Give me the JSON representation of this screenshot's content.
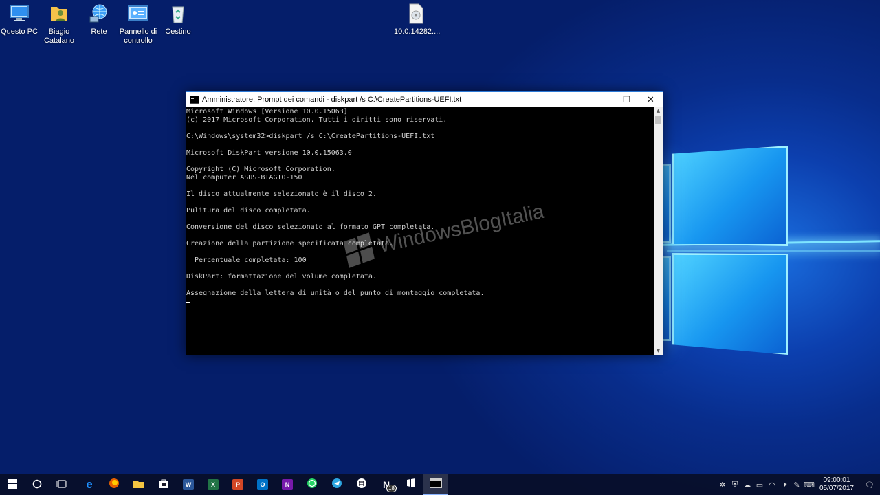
{
  "desktop": {
    "icons": [
      {
        "label": "Questo PC"
      },
      {
        "label": "Biagio Catalano"
      },
      {
        "label": "Rete"
      },
      {
        "label": "Pannello di controllo"
      },
      {
        "label": "Cestino"
      },
      {
        "label": "10.0.14282...."
      }
    ]
  },
  "window": {
    "title": "Amministratore: Prompt dei comandi - diskpart  /s C:\\CreatePartitions-UEFI.txt",
    "minimize_glyph": "—",
    "maximize_glyph": "☐",
    "close_glyph": "✕",
    "console_lines": [
      "Microsoft Windows [Versione 10.0.15063]",
      "(c) 2017 Microsoft Corporation. Tutti i diritti sono riservati.",
      "",
      "C:\\Windows\\system32>diskpart /s C:\\CreatePartitions-UEFI.txt",
      "",
      "Microsoft DiskPart versione 10.0.15063.0",
      "",
      "Copyright (C) Microsoft Corporation.",
      "Nel computer ASUS-BIAGIO-150",
      "",
      "Il disco attualmente selezionato è il disco 2.",
      "",
      "Pulitura del disco completata.",
      "",
      "Conversione del disco selezionato al formato GPT completata.",
      "",
      "Creazione della partizione specificata completata.",
      "",
      "  Percentuale completata: 100",
      "",
      "DiskPart: formattazione del volume completata.",
      "",
      "Assegnazione della lettera di unità o del punto di montaggio completata."
    ]
  },
  "watermark": "WindowsBlogItalia",
  "taskbar": {
    "apps": [
      {
        "name": "start-button",
        "icon": "windows-logo"
      },
      {
        "name": "search-button",
        "icon": "cortana-circle"
      },
      {
        "name": "task-view-button",
        "icon": "task-view"
      },
      {
        "name": "edge",
        "icon": "edge-e",
        "color": "#1e90ff",
        "glyph": "e"
      },
      {
        "name": "firefox",
        "icon": "firefox",
        "color": "#e66000",
        "glyph": ""
      },
      {
        "name": "file-explorer",
        "icon": "folder",
        "color": "#f4c542",
        "glyph": ""
      },
      {
        "name": "store",
        "icon": "store-bag",
        "color": "#ffffff",
        "glyph": ""
      },
      {
        "name": "word",
        "icon": "word",
        "color": "#2b579a",
        "glyph": "W"
      },
      {
        "name": "excel",
        "icon": "excel",
        "color": "#217346",
        "glyph": "X"
      },
      {
        "name": "powerpoint",
        "icon": "powerpoint",
        "color": "#d24726",
        "glyph": "P"
      },
      {
        "name": "outlook",
        "icon": "outlook",
        "color": "#0072c6",
        "glyph": "O"
      },
      {
        "name": "onenote",
        "icon": "onenote",
        "color": "#7719aa",
        "glyph": "N"
      },
      {
        "name": "whatsapp",
        "icon": "whatsapp",
        "color": "#25d366",
        "glyph": ""
      },
      {
        "name": "telegram",
        "icon": "telegram",
        "color": "#2ca5e0",
        "glyph": ""
      },
      {
        "name": "slack",
        "icon": "slack",
        "color": "#ffffff",
        "glyph": ""
      },
      {
        "name": "notification-app",
        "icon": "n-badge",
        "color": "#ffffff",
        "glyph": "N",
        "badge": "18"
      },
      {
        "name": "windows-app",
        "icon": "windows-flag",
        "color": "#ffffff",
        "glyph": ""
      },
      {
        "name": "command-prompt",
        "icon": "cmd",
        "color": "#000000",
        "glyph": ""
      }
    ],
    "clock": {
      "time": "09:00:01",
      "date": "05/07/2017"
    }
  }
}
